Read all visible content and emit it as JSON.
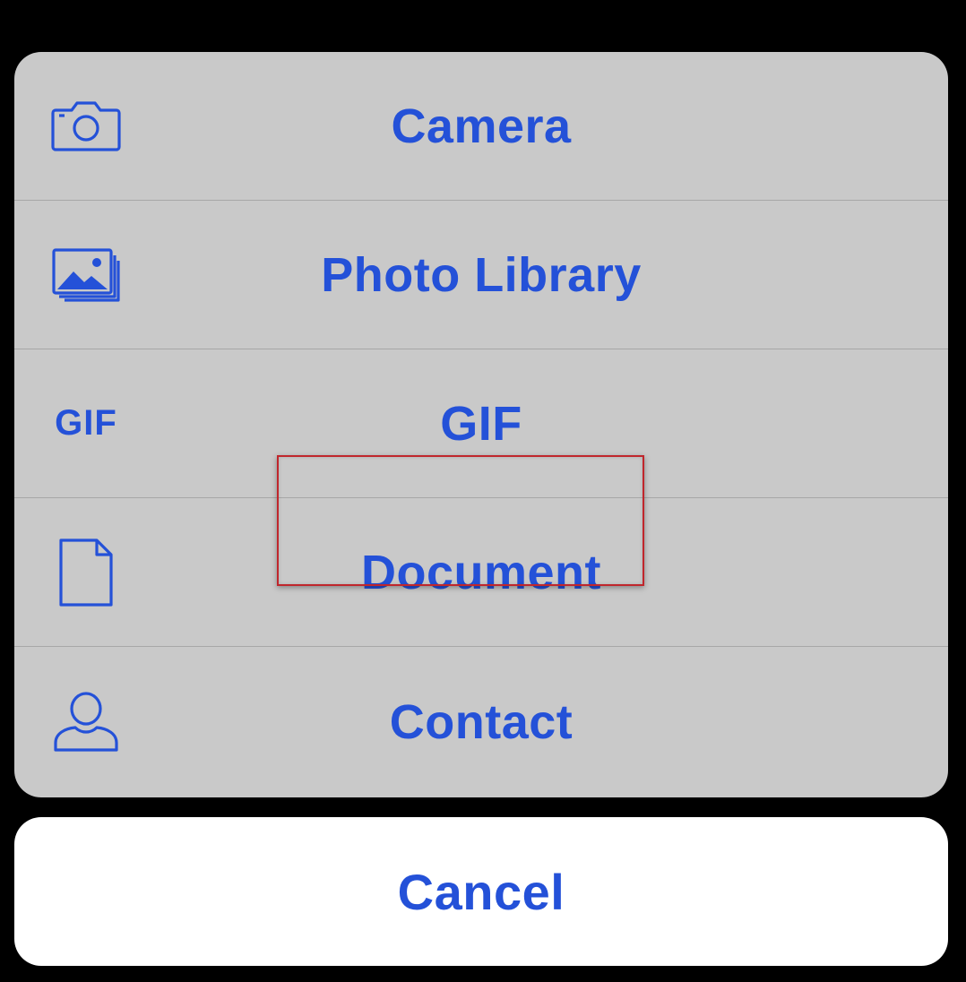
{
  "accent_color": "#2451d8",
  "highlight_color": "#c0262c",
  "sheet": {
    "items": [
      {
        "label": "Camera",
        "icon": "camera-icon"
      },
      {
        "label": "Photo Library",
        "icon": "photo-library-icon"
      },
      {
        "label": "GIF",
        "icon": "gif-icon",
        "icon_text": "GIF"
      },
      {
        "label": "Document",
        "icon": "document-icon",
        "highlighted": true
      },
      {
        "label": "Contact",
        "icon": "contact-icon"
      }
    ]
  },
  "cancel": {
    "label": "Cancel"
  }
}
